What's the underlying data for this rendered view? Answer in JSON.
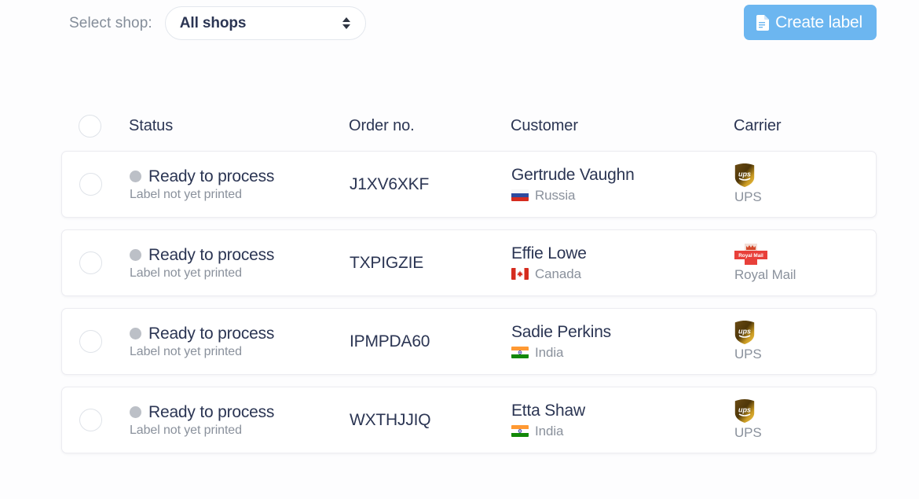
{
  "toolbar": {
    "shop_label": "Select shop:",
    "shop_selected": "All shops",
    "create_label": "Create label",
    "create_label_icon": "document-icon",
    "accent_color": "#6cb6f0"
  },
  "table": {
    "headers": {
      "status": "Status",
      "order": "Order no.",
      "customer": "Customer",
      "carrier": "Carrier"
    },
    "rows": [
      {
        "status": "Ready to process",
        "status_sub": "Label not yet printed",
        "status_color": "#bcc0c7",
        "order": "J1XV6XKF",
        "customer": "Gertrude Vaughn",
        "country": "Russia",
        "country_flag": "flag-russia",
        "carrier": "UPS",
        "carrier_logo": "ups-logo"
      },
      {
        "status": "Ready to process",
        "status_sub": "Label not yet printed",
        "status_color": "#bcc0c7",
        "order": "TXPIGZIE",
        "customer": "Effie Lowe",
        "country": "Canada",
        "country_flag": "flag-canada",
        "carrier": "Royal Mail",
        "carrier_logo": "royal-mail-logo"
      },
      {
        "status": "Ready to process",
        "status_sub": "Label not yet printed",
        "status_color": "#bcc0c7",
        "order": "IPMPDA60",
        "customer": "Sadie Perkins",
        "country": "India",
        "country_flag": "flag-india",
        "carrier": "UPS",
        "carrier_logo": "ups-logo"
      },
      {
        "status": "Ready to process",
        "status_sub": "Label not yet printed",
        "status_color": "#bcc0c7",
        "order": "WXTHJJIQ",
        "customer": "Etta Shaw",
        "country": "India",
        "country_flag": "flag-india",
        "carrier": "UPS",
        "carrier_logo": "ups-logo"
      }
    ]
  }
}
